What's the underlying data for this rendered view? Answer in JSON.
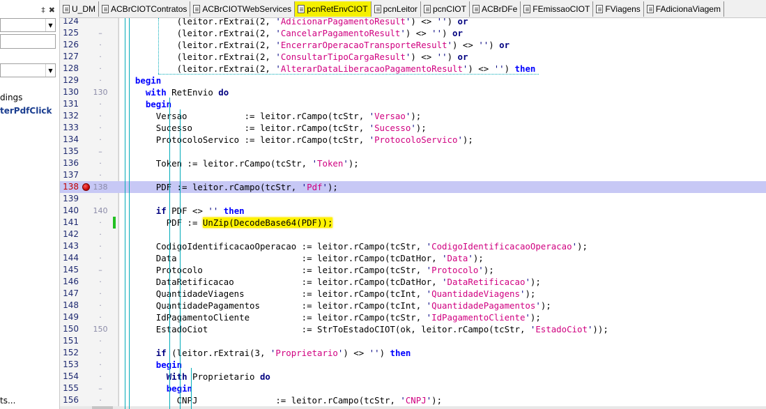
{
  "left_panel": {
    "pin_symbol": "‡",
    "close_symbol": "✖",
    "text_1": "dings",
    "text_2": "terPdfClick",
    "text_3": "ts..."
  },
  "tabs": [
    {
      "label": "U_DM",
      "active": false
    },
    {
      "label": "ACBrCIOTContratos",
      "active": false
    },
    {
      "label": "ACBrCIOTWebServices",
      "active": false
    },
    {
      "label": "pcnRetEnvCIOT",
      "active": true
    },
    {
      "label": "pcnLeitor",
      "active": false
    },
    {
      "label": "pcnCIOT",
      "active": false
    },
    {
      "label": "ACBrDFe",
      "active": false
    },
    {
      "label": "FEmissaoCIOT",
      "active": false
    },
    {
      "label": "FViagens",
      "active": false
    },
    {
      "label": "FAdicionaViagem",
      "active": false
    }
  ],
  "editor": {
    "lines": [
      {
        "n": "124",
        "mark": ""
      },
      {
        "n": "125",
        "mark": "–"
      },
      {
        "n": "126",
        "mark": "·"
      },
      {
        "n": "127",
        "mark": "·"
      },
      {
        "n": "128",
        "mark": "·"
      },
      {
        "n": "129",
        "mark": "·"
      },
      {
        "n": "130",
        "mark": "130"
      },
      {
        "n": "131",
        "mark": "·"
      },
      {
        "n": "132",
        "mark": "·"
      },
      {
        "n": "133",
        "mark": "·"
      },
      {
        "n": "134",
        "mark": "·"
      },
      {
        "n": "135",
        "mark": "–"
      },
      {
        "n": "136",
        "mark": "·"
      },
      {
        "n": "137",
        "mark": "·"
      },
      {
        "n": "138",
        "mark": "138"
      },
      {
        "n": "139",
        "mark": "·"
      },
      {
        "n": "140",
        "mark": "140"
      },
      {
        "n": "141",
        "mark": "·"
      },
      {
        "n": "142",
        "mark": "·"
      },
      {
        "n": "143",
        "mark": "·"
      },
      {
        "n": "144",
        "mark": "·"
      },
      {
        "n": "145",
        "mark": "–"
      },
      {
        "n": "146",
        "mark": "·"
      },
      {
        "n": "147",
        "mark": "·"
      },
      {
        "n": "148",
        "mark": "·"
      },
      {
        "n": "149",
        "mark": "·"
      },
      {
        "n": "150",
        "mark": "150"
      },
      {
        "n": "151",
        "mark": "·"
      },
      {
        "n": "152",
        "mark": "·"
      },
      {
        "n": "153",
        "mark": "·"
      },
      {
        "n": "154",
        "mark": "·"
      },
      {
        "n": "155",
        "mark": "–"
      },
      {
        "n": "156",
        "mark": "·"
      }
    ],
    "code": [
      "          (leitor.rExtrai(2, 'AdicionarPagamentoResult') <> '') or",
      "          (leitor.rExtrai(2, 'CancelarPagamentoResult') <> '') or",
      "          (leitor.rExtrai(2, 'EncerrarOperacaoTransporteResult') <> '') or",
      "          (leitor.rExtrai(2, 'ConsultarTipoCargaResult') <> '') or",
      "          (leitor.rExtrai(2, 'AlterarDataLiberacaoPagamentoResult') <> '') then",
      "  begin",
      "    with RetEnvio do",
      "    begin",
      "      Versao           := leitor.rCampo(tcStr, 'Versao');",
      "      Sucesso          := leitor.rCampo(tcStr, 'Sucesso');",
      "      ProtocoloServico := leitor.rCampo(tcStr, 'ProtocoloServico');",
      "",
      "      Token := leitor.rCampo(tcStr, 'Token');",
      "",
      "      PDF := leitor.rCampo(tcStr, 'Pdf');",
      "",
      "      if PDF <> '' then",
      "        PDF := UnZip(DecodeBase64(PDF));",
      "",
      "      CodigoIdentificacaoOperacao := leitor.rCampo(tcStr, 'CodigoIdentificacaoOperacao');",
      "      Data                        := leitor.rCampo(tcDatHor, 'Data');",
      "      Protocolo                   := leitor.rCampo(tcStr, 'Protocolo');",
      "      DataRetificacao             := leitor.rCampo(tcDatHor, 'DataRetificacao');",
      "      QuantidadeViagens           := leitor.rCampo(tcInt, 'QuantidadeViagens');",
      "      QuantidadePagamentos        := leitor.rCampo(tcInt, 'QuantidadePagamentos');",
      "      IdPagamentoCliente          := leitor.rCampo(tcStr, 'IdPagamentoCliente');",
      "      EstadoCiot                  := StrToEstadoCIOT(ok, leitor.rCampo(tcStr, 'EstadoCiot'));",
      "",
      "      if (leitor.rExtrai(3, 'Proprietario') <> '') then",
      "      begin",
      "        With Proprietario do",
      "        begin",
      "          CNPJ               := leitor.rCampo(tcStr, 'CNPJ');"
    ],
    "breakpoint_line": "138",
    "execution_line": "138",
    "changed_line": "141",
    "highlighted_text": "UnZip(DecodeBase64(PDF));"
  }
}
